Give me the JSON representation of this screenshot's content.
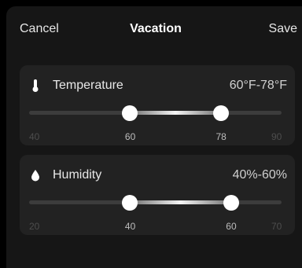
{
  "header": {
    "cancel_label": "Cancel",
    "title": "Vacation",
    "save_label": "Save"
  },
  "temperature": {
    "icon": "thermometer-icon",
    "label": "Temperature",
    "range_text": "60°F-78°F",
    "min": 40,
    "max": 90,
    "low": 60,
    "high": 78,
    "ticks": {
      "min": "40",
      "low": "60",
      "high": "78",
      "max": "90"
    }
  },
  "humidity": {
    "icon": "water-drop-icon",
    "label": "Humidity",
    "range_text": "40%-60%",
    "min": 20,
    "max": 70,
    "low": 40,
    "high": 60,
    "ticks": {
      "min": "20",
      "low": "40",
      "high": "60",
      "max": "70"
    }
  },
  "colors": {
    "background": "#000000",
    "sheet": "#161616",
    "card": "#222222",
    "accent": "#ffffff"
  }
}
